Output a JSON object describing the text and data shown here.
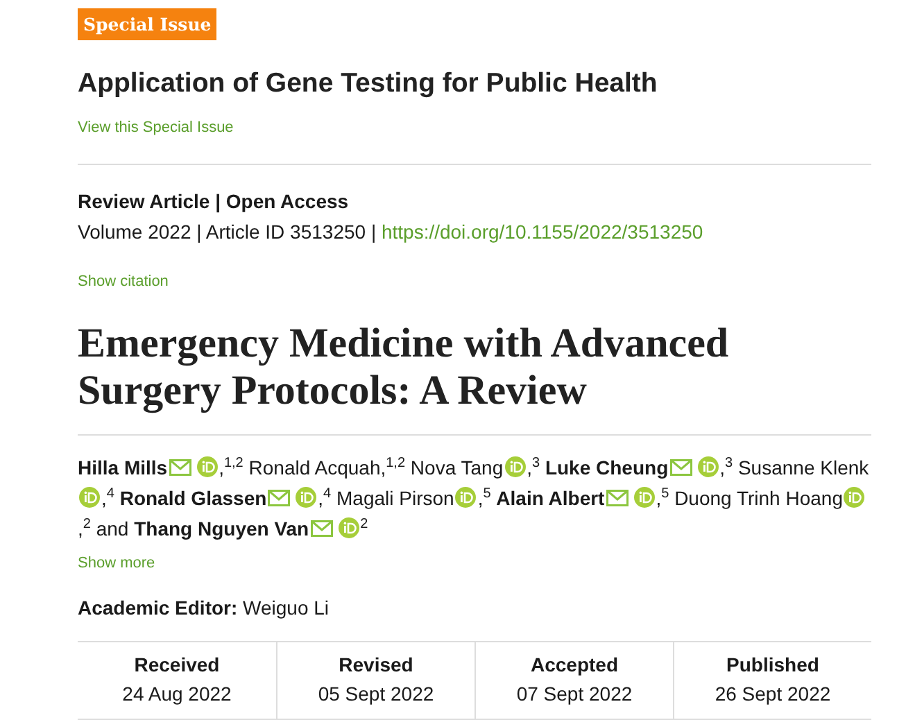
{
  "badge": "Special Issue",
  "special_issue": {
    "title": "Application of Gene Testing for Public Health",
    "link": "View this Special Issue"
  },
  "article_type": "Review Article | Open Access",
  "meta": {
    "volume": "Volume 2022 | Article ID 3513250 | ",
    "doi": "https://doi.org/10.1155/2022/3513250"
  },
  "show_citation": "Show citation",
  "title": "Emergency Medicine with Advanced Surgery Protocols: A Review",
  "authors": [
    {
      "name": "Hilla Mills",
      "corresponding": true,
      "email": true,
      "orcid": true,
      "separator": ",",
      "affiliations": "1,2"
    },
    {
      "name": "Ronald Acquah,",
      "corresponding": false,
      "email": false,
      "orcid": false,
      "affiliations": "1,2"
    },
    {
      "name": "Nova Tang",
      "corresponding": false,
      "email": false,
      "orcid": true,
      "separator": ",",
      "affiliations": "3"
    },
    {
      "name": "Luke Cheung",
      "corresponding": true,
      "email": true,
      "orcid": true,
      "separator": ",",
      "affiliations": "3"
    },
    {
      "name": "Susanne Klenk",
      "corresponding": false,
      "email": false,
      "orcid": true,
      "separator": ",",
      "affiliations": "4"
    },
    {
      "name": "Ronald Glassen",
      "corresponding": true,
      "email": true,
      "orcid": true,
      "separator": ",",
      "affiliations": "4"
    },
    {
      "name": "Magali Pirson",
      "corresponding": false,
      "email": false,
      "orcid": true,
      "separator": ",",
      "affiliations": "5"
    },
    {
      "name": "Alain Albert",
      "corresponding": true,
      "email": true,
      "orcid": true,
      "separator": ",",
      "affiliations": "5"
    },
    {
      "name": "Duong Trinh Hoang",
      "corresponding": false,
      "email": false,
      "orcid": true,
      "separator": ",",
      "affiliations": "2"
    },
    {
      "name": "Thang Nguyen Van",
      "corresponding": true,
      "email": true,
      "orcid": true,
      "joiner": "and",
      "affiliations": "2"
    }
  ],
  "show_more": "Show more",
  "editor": {
    "label": "Academic Editor:",
    "name": "Weiguo Li"
  },
  "dates": [
    {
      "label": "Received",
      "date": "24 Aug 2022"
    },
    {
      "label": "Revised",
      "date": "05 Sept 2022"
    },
    {
      "label": "Accepted",
      "date": "07 Sept 2022"
    },
    {
      "label": "Published",
      "date": "26 Sept 2022"
    }
  ]
}
